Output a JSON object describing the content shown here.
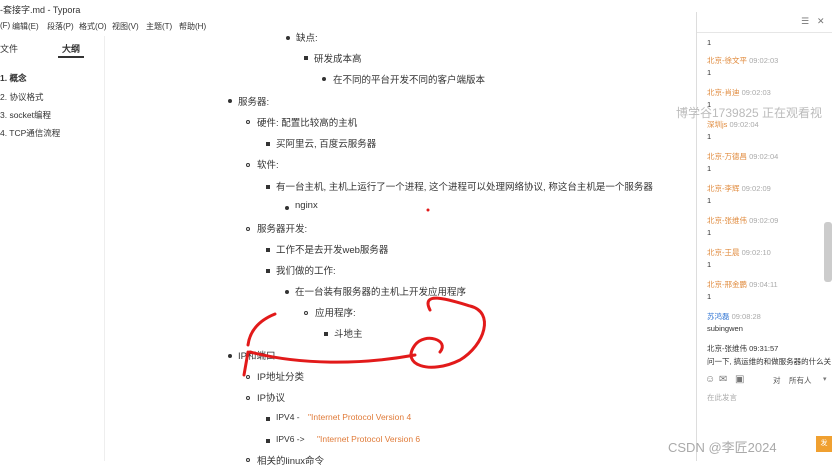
{
  "window": {
    "title": "-套接字.md - Typora"
  },
  "menu": [
    "(F)",
    "编辑(E)",
    "段落(P)",
    "格式(O)",
    "视图(V)",
    "主题(T)",
    "帮助(H)"
  ],
  "sidebar": {
    "tabs": [
      "文件",
      "大纲"
    ],
    "outline": [
      "1. 概念",
      "2. 协议格式",
      "3. socket编程",
      "4. TCP通信流程"
    ]
  },
  "doc": {
    "l1": "缺点:",
    "l2": "研发成本高",
    "l3": "在不同的平台开发不同的客户端版本",
    "l4": "服务器:",
    "l5": "硬件: 配置比较高的主机",
    "l6": "买阿里云, 百度云服务器",
    "l7": "软件:",
    "l8": "有一台主机, 主机上运行了一个进程, 这个进程可以处理网络协议, 称这台主机是一个服务器",
    "l9": "nginx",
    "l10": "服务器开发:",
    "l11": "工作不是去开发web服务器",
    "l12": "我们做的工作:",
    "l13": "在一台装有服务器的主机上开发应用程序",
    "l14": "应用程序:",
    "l15": "斗地主",
    "l16": "IP和端口",
    "l17": "IP地址分类",
    "l18": "IP协议",
    "l19a": "IPV4 -",
    "l19b": "\"Internet Protocol Version 4",
    "l20a": "IPV6 ->",
    "l20b": "\"Internet Protocol Version 6",
    "l21": "相关的linux命令"
  },
  "chat": {
    "messages": [
      {
        "name": "",
        "time": "",
        "text": "1"
      },
      {
        "name": "北京-徐文平",
        "time": "09:02:03",
        "text": "1"
      },
      {
        "name": "北京-肖迪",
        "time": "09:02:03",
        "text": "1"
      },
      {
        "name": "深圳js",
        "time": "09:02:04",
        "text": "1"
      },
      {
        "name": "北京-万德昌",
        "time": "09:02:04",
        "text": "1"
      },
      {
        "name": "北京-李辉",
        "time": "09:02:09",
        "text": "1"
      },
      {
        "name": "北京-张维伟",
        "time": "09:02:09",
        "text": "1"
      },
      {
        "name": "北京-王晨",
        "time": "09:02:10",
        "text": "1"
      },
      {
        "name": "北京-邢金鹏",
        "time": "09:04:11",
        "text": "1"
      },
      {
        "name": "苏鸿磊",
        "time": "09:08:28",
        "text": "subingwen"
      },
      {
        "name": "北京-张维伟",
        "time": "09:31:57",
        "text": "问一下, 搞运维的和做服务器的什么关"
      }
    ],
    "viewer_notice": "博学谷1739825 正在观看视",
    "filter_label": "对",
    "filter_value": "所有人",
    "input_hint": "在此发言",
    "send": "发"
  },
  "watermark": "CSDN @李匠2024"
}
